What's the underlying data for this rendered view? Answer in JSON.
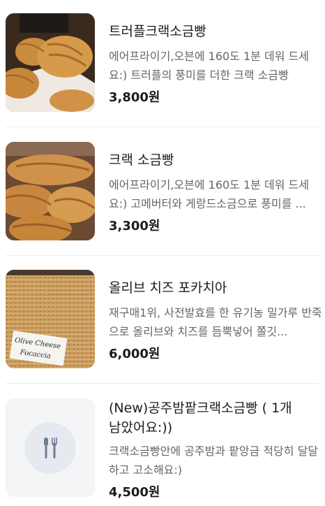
{
  "menu_items": [
    {
      "title": "트러플크랙소금빵",
      "description": "에어프라이기,오븐에 160도 1분 데워 드세요:) 트러플의 풍미를 더한 크랙 소금빵",
      "price": "3,800원",
      "image": "truffle-salt-bread-photo"
    },
    {
      "title": "크랙 소금빵",
      "description": "에어프라이기,오븐에 160도 1분 데워 드세요:) 고메버터와 게랑드소금으로 풍미를 ...",
      "price": "3,300원",
      "image": "crack-salt-bread-photo"
    },
    {
      "title": "올리브 치즈 포카치아",
      "description": "재구매1위, 사전발효를 한 유기농 밀가루 반죽으로 올리브와 치즈를 듬뿍넣어 쫄깃...",
      "price": "6,000원",
      "image": "olive-cheese-focaccia-photo",
      "image_label": "Olive Cheese Focaccia"
    },
    {
      "title": "(New)공주밤팥크랙소금빵 ( 1개 남았어요:))",
      "description": "크랙소금빵안에 공주밤과 팥앙금 적당히 달달하고 고소해요:)",
      "price": "4,500원",
      "image": "utensils-icon"
    }
  ],
  "colors": {
    "title": "#1c1c1c",
    "description": "#666666",
    "divider": "#ececec",
    "placeholder_bg": "#f4f5f7",
    "placeholder_icon": "#6f7f99"
  }
}
